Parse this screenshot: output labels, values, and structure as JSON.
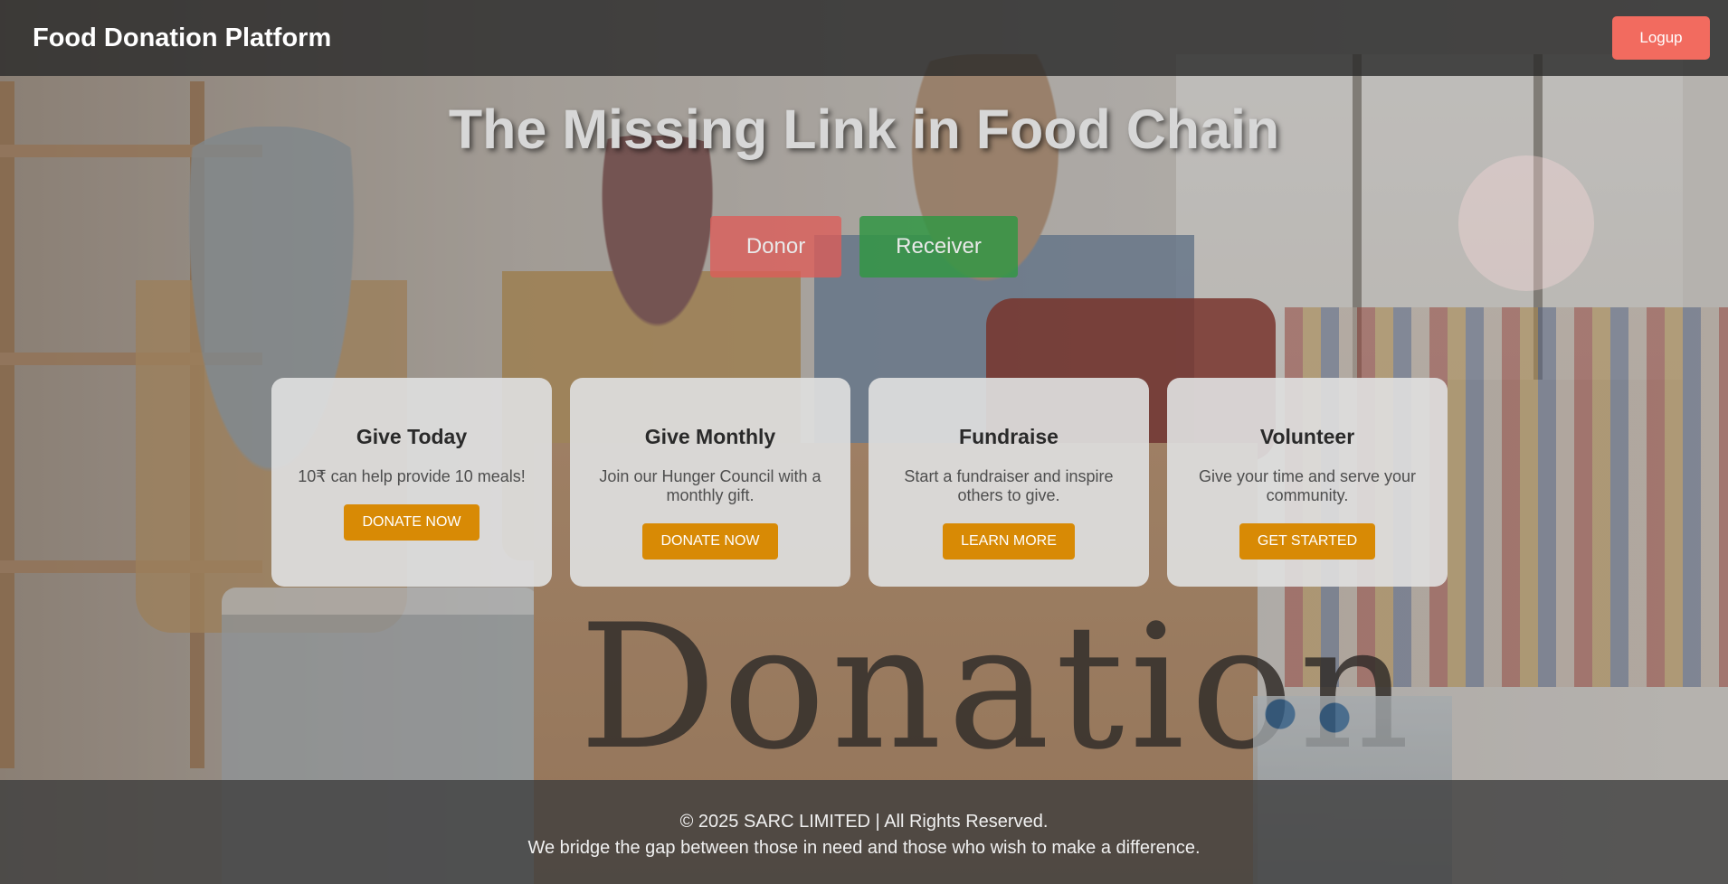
{
  "header": {
    "brand": "Food Donation Platform",
    "logout_label": "Logup"
  },
  "hero": {
    "title": "The Missing Link in Food Chain",
    "donor_label": "Donor",
    "receiver_label": "Receiver"
  },
  "background": {
    "box_word": "Donation"
  },
  "cards": [
    {
      "title": "Give Today",
      "text": "10₹ can help provide 10 meals!",
      "button": "DONATE NOW"
    },
    {
      "title": "Give Monthly",
      "text": "Join our Hunger Council with a monthly gift.",
      "button": "DONATE NOW"
    },
    {
      "title": "Fundraise",
      "text": "Start a fundraiser and inspire others to give.",
      "button": "LEARN MORE"
    },
    {
      "title": "Volunteer",
      "text": "Give your time and serve your community.",
      "button": "GET STARTED"
    }
  ],
  "footer": {
    "copyright": "© 2025 SARC LIMITED | All Rights Reserved.",
    "tagline": "We bridge the gap between those in need and those who wish to make a difference."
  },
  "colors": {
    "logout": "#f26b5f",
    "donor": "#de5c58",
    "receiver": "#329644",
    "card_button": "#d88a05"
  }
}
